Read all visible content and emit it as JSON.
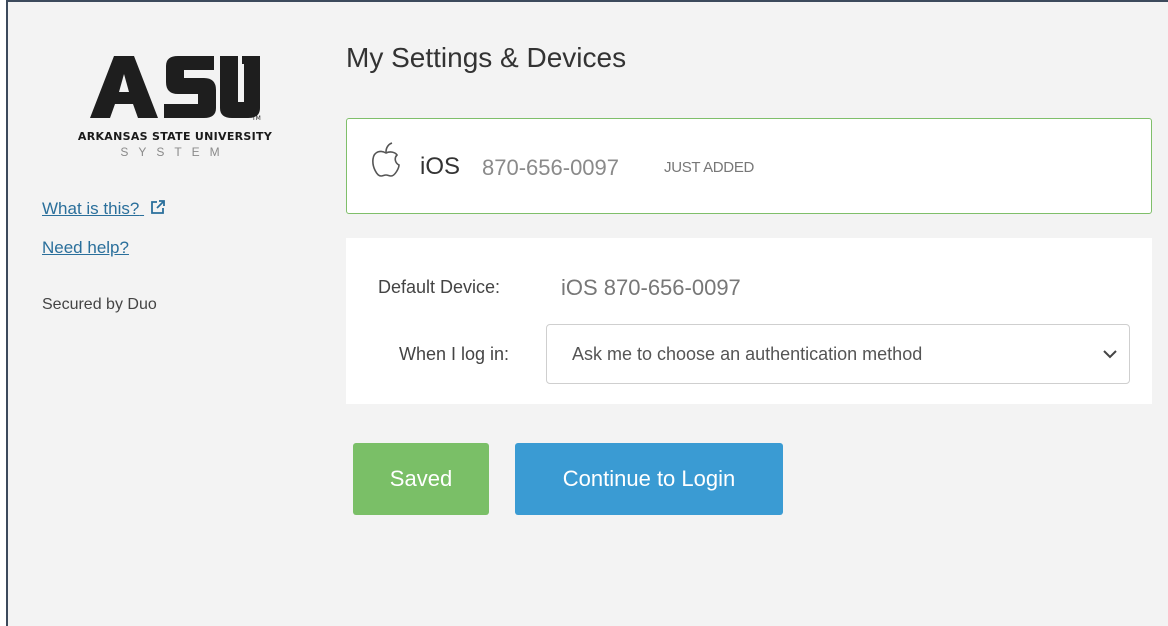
{
  "sidebar": {
    "logo_letters": "ASU",
    "logo_line1": "ARKANSAS STATE UNIVERSITY",
    "logo_line2": "SYSTEM",
    "what_is_this": "What is this?",
    "need_help": "Need help?",
    "secured_by": "Secured by Duo"
  },
  "main": {
    "title": "My Settings & Devices",
    "device": {
      "icon": "apple-icon",
      "os": "iOS",
      "number": "870-656-0097",
      "badge": "JUST ADDED"
    },
    "settings": {
      "default_device_label": "Default Device:",
      "default_device_value": "iOS 870-656-0097",
      "login_label": "When I log in:",
      "login_selected": "Ask me to choose an authentication method"
    },
    "buttons": {
      "saved": "Saved",
      "continue": "Continue to Login"
    }
  },
  "colors": {
    "background": "#f3f3f3",
    "link": "#2a6f9b",
    "device_border": "#7fbf6a",
    "saved_button": "#7abf67",
    "continue_button": "#3a9bd3"
  }
}
